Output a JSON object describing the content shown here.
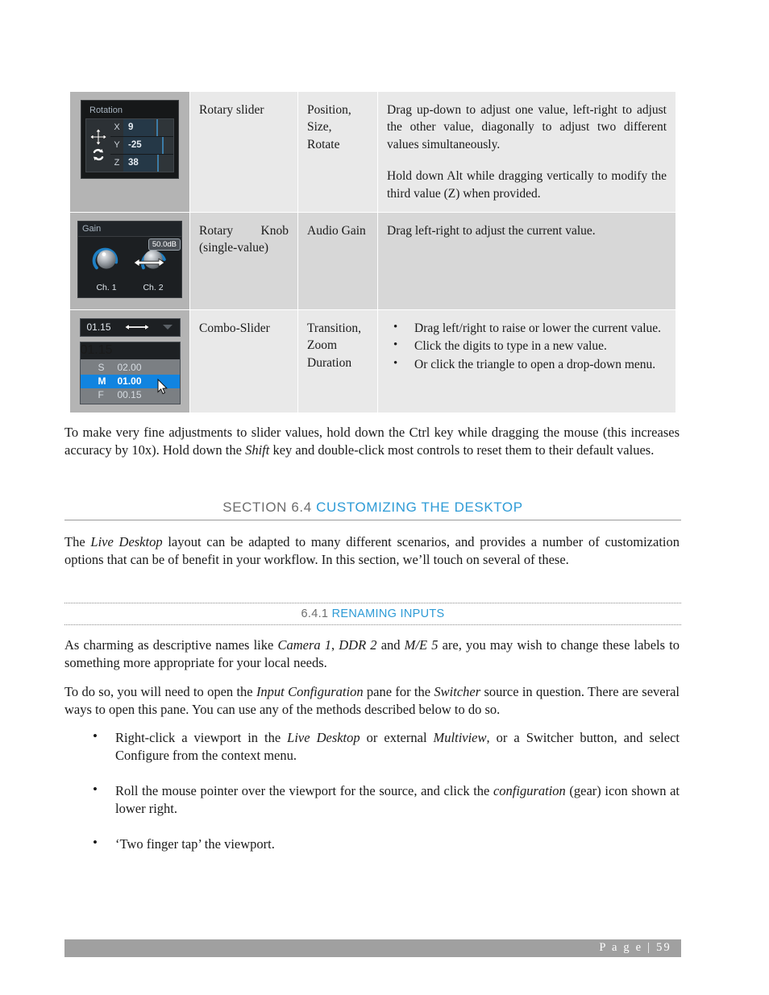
{
  "page": {
    "footer_label": "P a g e",
    "footer_separator": "|",
    "footer_number": "59"
  },
  "table": {
    "rows": [
      {
        "widget": "rotation-widget",
        "name": "Rotary slider",
        "usage": "Position,\nSize,\nRotate",
        "description_paragraphs": [
          "Drag up-down to adjust one value, left-right to adjust the other value, diagonally to adjust two different values simultaneously.",
          "Hold down Alt while dragging vertically to modify the third value (Z) when provided."
        ],
        "description_bullets": []
      },
      {
        "widget": "gain-widget",
        "name": "Rotary Knob (single-value)",
        "usage": "Audio Gain",
        "description_paragraphs": [
          "Drag left-right to adjust the current value."
        ],
        "description_bullets": []
      },
      {
        "widget": "combo-slider-widget",
        "name": "Combo-Slider",
        "usage": "Transition,\nZoom\nDuration",
        "description_paragraphs": [],
        "description_bullets": [
          "Drag left/right to raise or lower the current value.",
          "Click the digits to type in a new value.",
          "Or click the triangle to open a drop-down menu."
        ]
      }
    ]
  },
  "widgets": {
    "rotation": {
      "title": "Rotation",
      "axes": [
        {
          "label": "X",
          "value": "9",
          "fill_pct": 62,
          "tick_pct": 66
        },
        {
          "label": "Y",
          "value": "-25",
          "fill_pct": 76,
          "tick_pct": 80
        },
        {
          "label": "Z",
          "value": "38",
          "fill_pct": 64,
          "tick_pct": 68
        }
      ],
      "move_icon": "four-way-arrow-icon",
      "rotate_icon": "rotate-icon"
    },
    "gain": {
      "title": "Gain",
      "tooltip": "50.0dB",
      "channels": [
        {
          "label": "Ch. 1"
        },
        {
          "label": "Ch. 2"
        }
      ]
    },
    "combo_slider": {
      "top_value": "01.15",
      "open_value": "01.15",
      "options": [
        {
          "key": "S",
          "value": "02.00",
          "selected": false
        },
        {
          "key": "M",
          "value": "01.00",
          "selected": true
        },
        {
          "key": "F",
          "value": "00.15",
          "selected": false
        }
      ]
    }
  },
  "content": {
    "intro_paragraph": {
      "part1": "To make very fine adjustments to slider values, hold down the Ctrl key while dragging the mouse (this increases accuracy by 10x). Hold down the ",
      "italic1": "Shift",
      "part2": " key and double-click most controls to reset them to their default values."
    },
    "section_heading": {
      "number": "SECTION 6.4",
      "title": "CUSTOMIZING THE DESKTOP"
    },
    "section_paragraph": {
      "part1": "The ",
      "italic1": "Live Desktop",
      "part2": " layout can be adapted to many different scenarios, and provides a number of customization options that can be of benefit in your workflow.  In this section, we’ll touch on several of these."
    },
    "subsection_heading": {
      "number": "6.4.1",
      "title": "RENAMING INPUTS"
    },
    "subsection_paragraph1": {
      "part1": "As charming as descriptive names like ",
      "italic1": "Camera 1",
      "part2": ", ",
      "italic2": "DDR 2",
      "part3": " and ",
      "italic3": "M/E 5",
      "part4": " are, you may wish to change these labels to something more appropriate for your local needs."
    },
    "subsection_paragraph2": {
      "part1": "To do so, you will need to open the ",
      "italic1": "Input Configuration",
      "part2": " pane for the ",
      "italic2": "Switcher",
      "part3": " source in question.  There are several ways to open this pane.  You can use any of the methods described below to do so."
    },
    "method_bullets": [
      {
        "part1": "Right-click a viewport in the ",
        "italic1": "Live Desktop",
        "part2": " or external ",
        "italic2": "Multiview",
        "part3": ", or a Switcher button, and select Configure from the context menu."
      },
      {
        "part1": "Roll the mouse pointer over the viewport for the source, and click the ",
        "italic1": "configuration",
        "part2": " (gear) icon shown at lower right."
      },
      {
        "part1": "‘Two finger tap’ the viewport.",
        "italic1": "",
        "part2": ""
      }
    ]
  },
  "colors": {
    "accent_blue": "#2e9bd6",
    "heading_gray": "#6d6d6d",
    "footer_gray": "#a0a0a0",
    "table_img_bg": "#b4b4b4",
    "table_cell_bg": "#e9e9e9",
    "table_cell_alt_bg": "#d7d7d7",
    "widget_highlight": "#1184e0"
  }
}
